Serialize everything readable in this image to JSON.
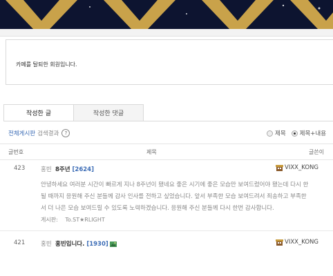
{
  "notice": {
    "text": "카페를 탈퇴한 회원입니다."
  },
  "tabs": [
    {
      "label": "작성한 글"
    },
    {
      "label": "작성한 댓글"
    }
  ],
  "filter": {
    "board_name": "전체게시판",
    "search_result": "검색결과",
    "radio_options": [
      {
        "label": "제목",
        "checked": false
      },
      {
        "label": "제목+내용",
        "checked": true
      }
    ]
  },
  "table": {
    "headers": {
      "number": "글번호",
      "title": "제목",
      "author": "글쓴이"
    },
    "rows": [
      {
        "number": "423",
        "prefix": "홍빈",
        "title": "8주년",
        "comment_count": "[2624]",
        "author": "VIXX_KONG",
        "excerpt": [
          "안녕하세요 여러분 시간이 빠르게 지나 8주년이 됐네요 좋은 시기에 좋은 모습만 보여드렸어야 됐는데 다시 한",
          "될 때까지 응원해 주신 분들께 감사 인사를 전하고 싶었습니다. 앞서 부족한 모습 보여드려서 죄송하고 부족한",
          "서 더 나은 모습 보여드릴 수 있도록 노력하겠습니다. 응원해 주신 분들께 다시 한번 감사합니다."
        ],
        "board_label": "게시판:",
        "board_value": "To.ST★RLIGHT"
      },
      {
        "number": "421",
        "prefix": "홍빈",
        "title": "홍빈입니다.",
        "comment_count": "[1930]",
        "author": "VIXX_KONG"
      }
    ]
  },
  "colors": {
    "banner_bg": "#0d1430",
    "banner_gold": "#c9a24a",
    "link_blue": "#3a6bb5"
  }
}
